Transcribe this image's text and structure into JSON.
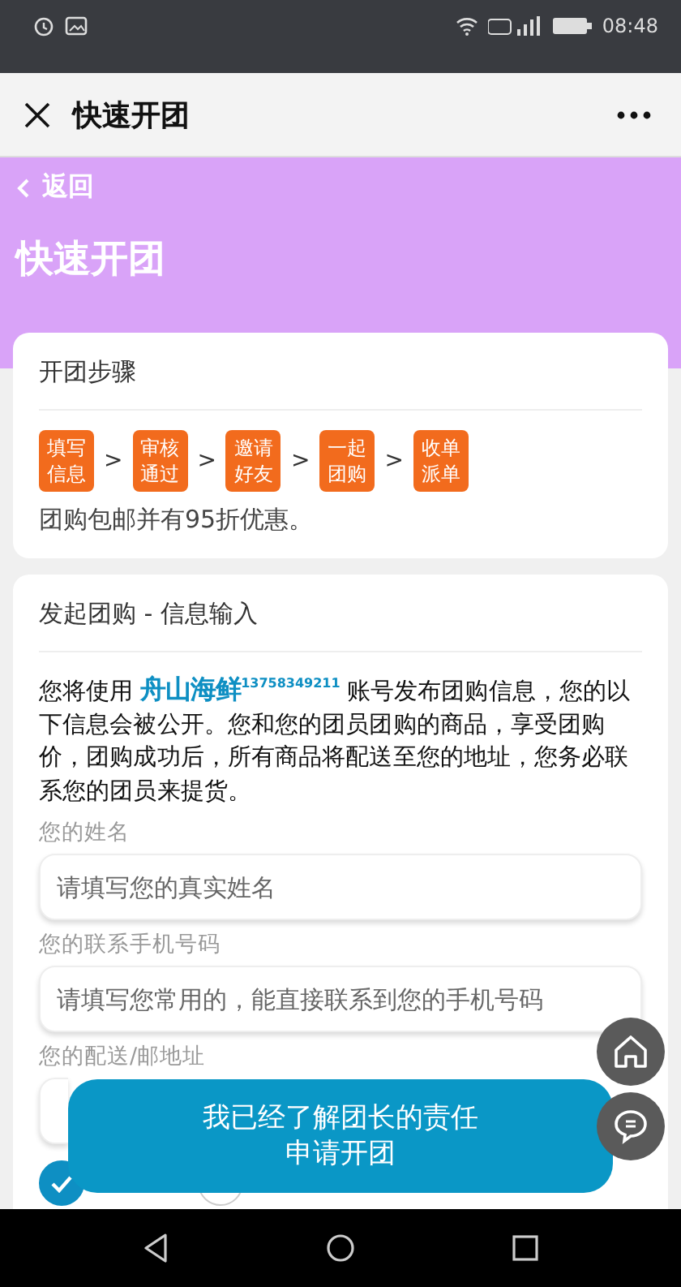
{
  "status_bar": {
    "time": "08:48"
  },
  "title_bar": {
    "title": "快速开团"
  },
  "header": {
    "back": "返回",
    "title": "快速开团"
  },
  "steps_card": {
    "title": "开团步骤",
    "steps": [
      "填写信息",
      "审核通过",
      "邀请好友",
      "一起团购",
      "收单派单"
    ],
    "separator": ">",
    "note": "团购包邮并有95折优惠。"
  },
  "form_card": {
    "title": "发起团购 - 信息输入",
    "intro": {
      "before": "您将使用 ",
      "account": "舟山海鲜",
      "account_number": "13758349211",
      "after": " 账号发布团购信息，您的以下信息会被公开。您和您的团员团购的商品，享受团购价，团购成功后，所有商品将配送至您的地址，您务必联系您的团员来提货。"
    },
    "fields": [
      {
        "label": "您的姓名",
        "placeholder": "请填写您的真实姓名"
      },
      {
        "label": "您的联系手机号码",
        "placeholder": "请填写您常用的，能直接联系到您的手机号码"
      },
      {
        "label": "您的配送/邮地址"
      }
    ],
    "delivery_options": [
      {
        "selected": true
      },
      {
        "selected": false
      }
    ]
  },
  "submit_button": {
    "lines": [
      "我已经了解团长的责任",
      "申请开团"
    ]
  }
}
